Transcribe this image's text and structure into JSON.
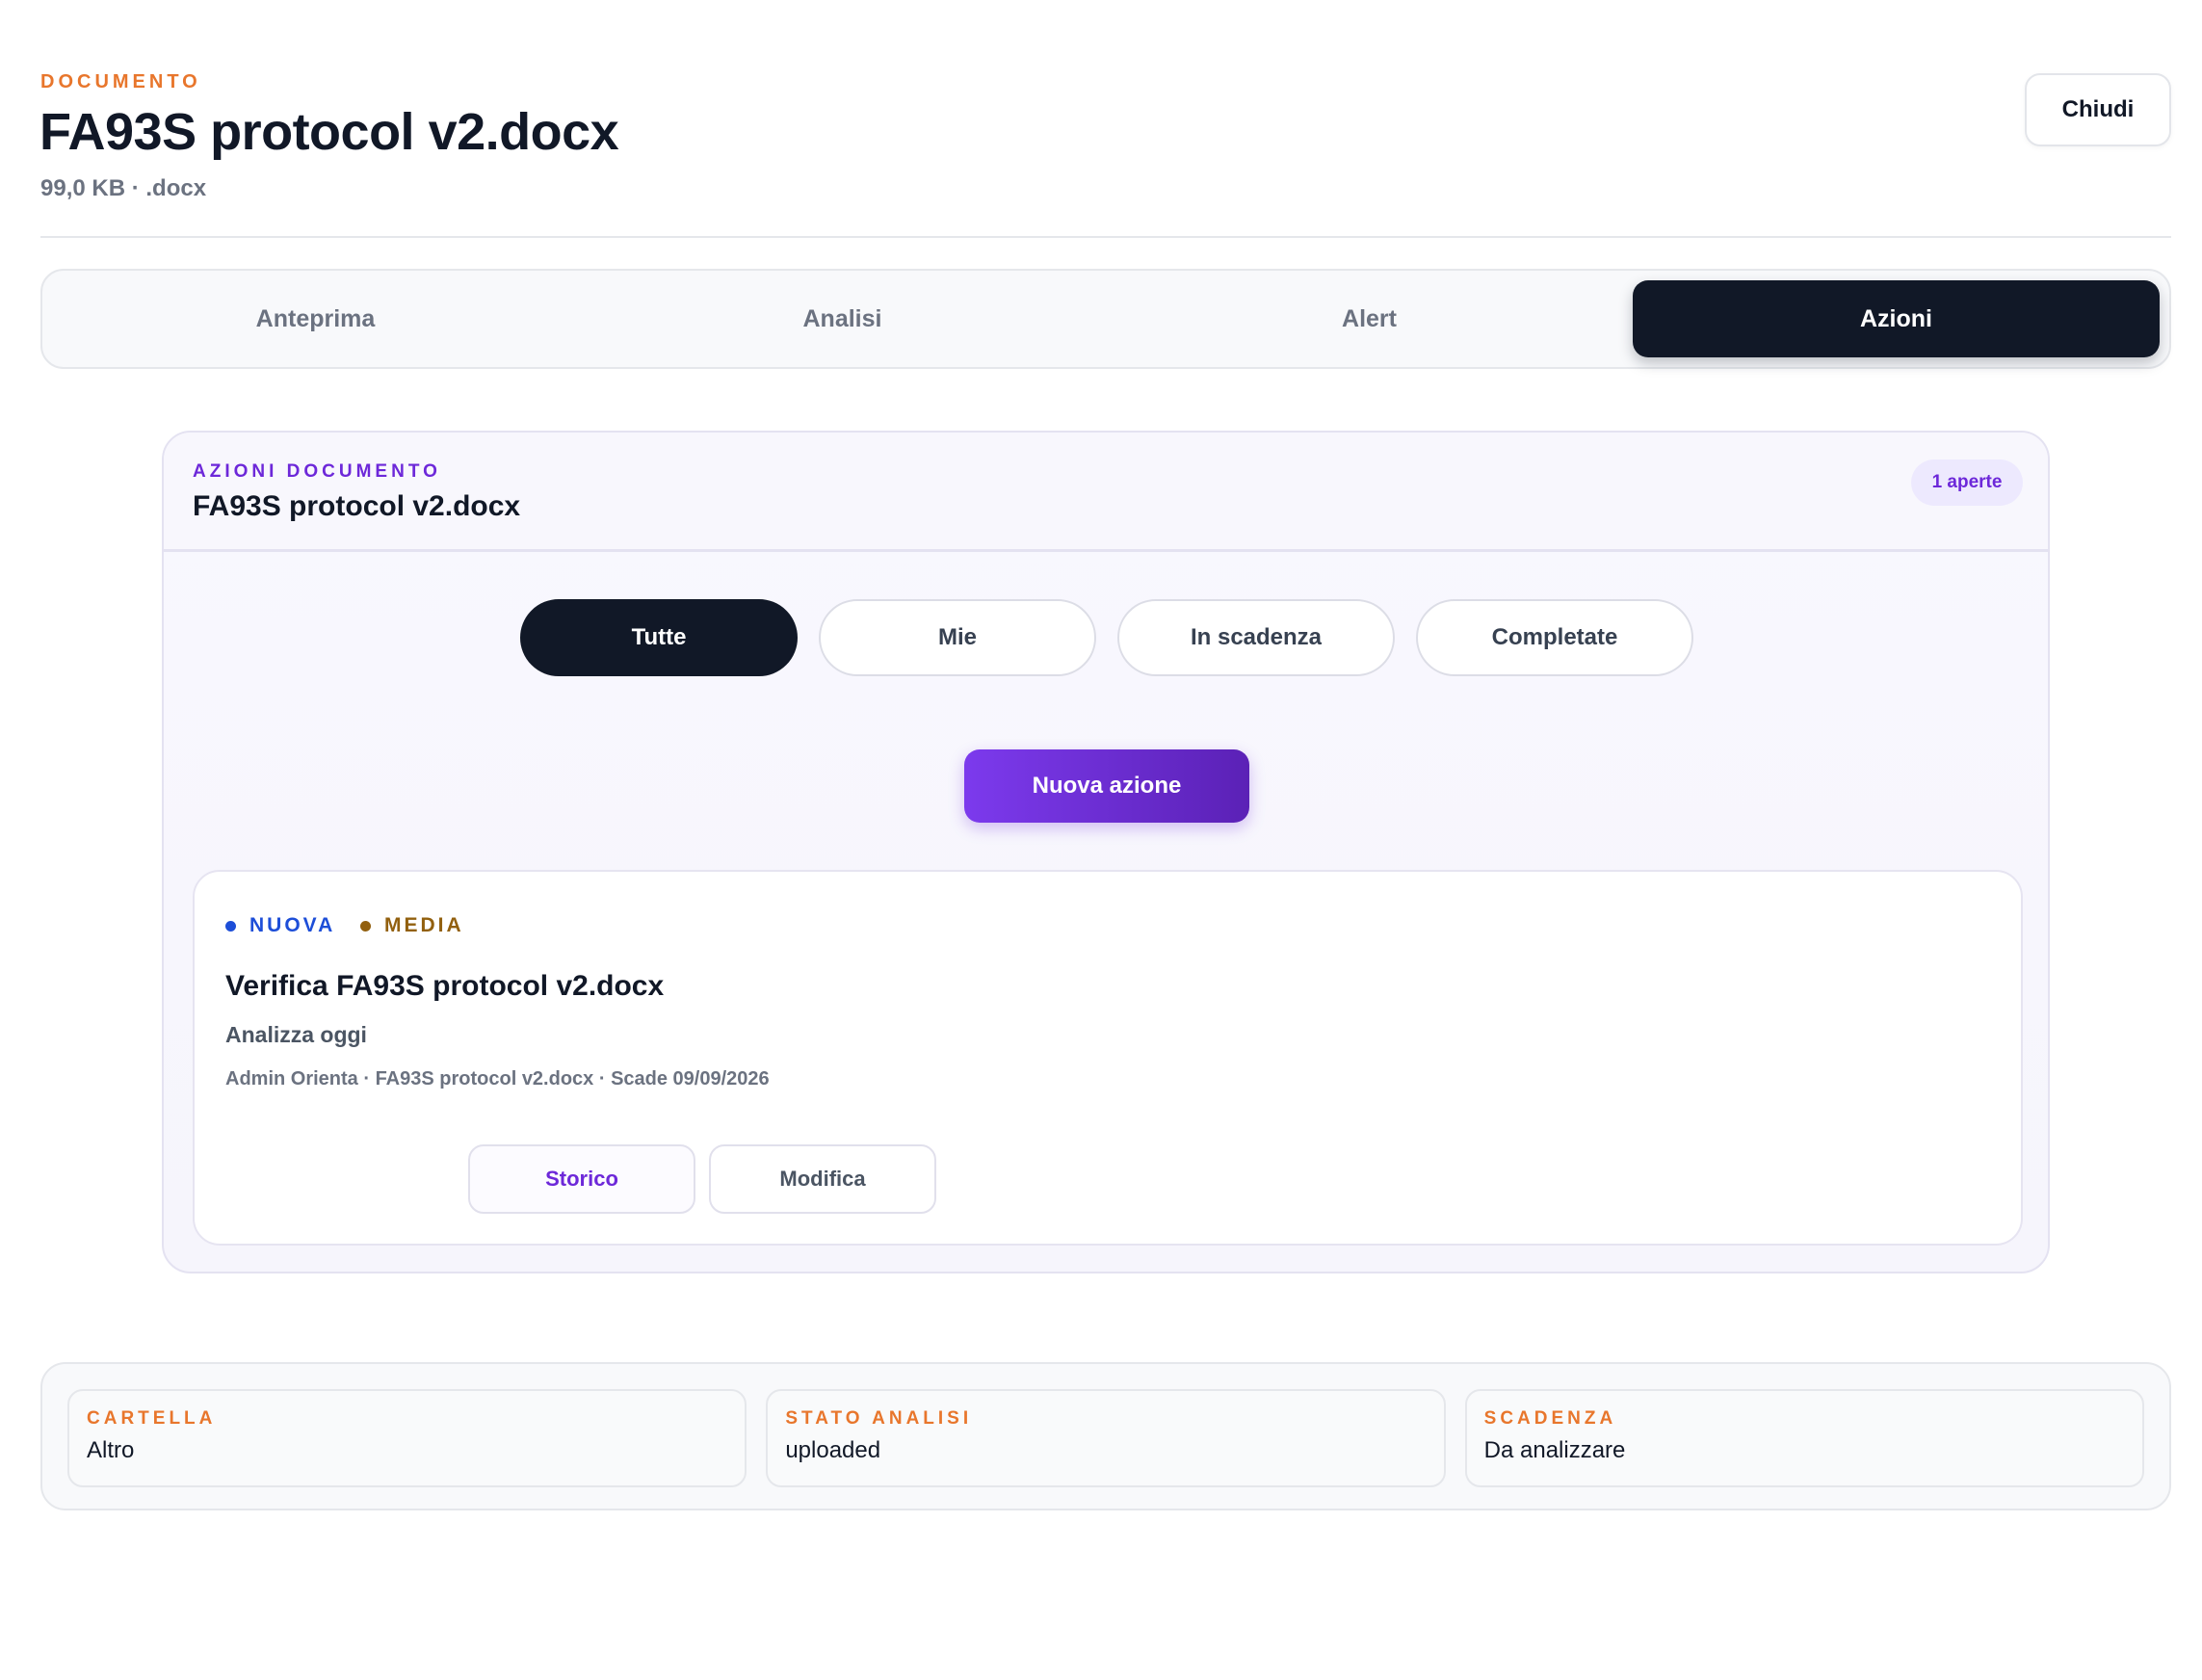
{
  "document": {
    "eyebrow": "DOCUMENTO",
    "title": "FA93S protocol v2.docx",
    "meta": "99,0 KB · .docx",
    "close_label": "Chiudi"
  },
  "tabs": [
    {
      "label": "Anteprima",
      "active": false
    },
    {
      "label": "Analisi",
      "active": false
    },
    {
      "label": "Alert",
      "active": false
    },
    {
      "label": "Azioni",
      "active": true
    }
  ],
  "actions": {
    "eyebrow": "AZIONI DOCUMENTO",
    "title": "FA93S protocol v2.docx",
    "open_badge": "1 aperte",
    "filters": [
      {
        "label": "Tutte",
        "active": true
      },
      {
        "label": "Mie",
        "active": false
      },
      {
        "label": "In scadenza",
        "active": false
      },
      {
        "label": "Completate",
        "active": false
      }
    ],
    "new_action_label": "Nuova azione",
    "items": [
      {
        "status": "NUOVA",
        "priority": "MEDIA",
        "title": "Verifica FA93S protocol v2.docx",
        "description": "Analizza oggi",
        "meta": "Admin Orienta · FA93S protocol v2.docx · Scade 09/09/2026",
        "history_label": "Storico",
        "edit_label": "Modifica"
      }
    ]
  },
  "info": [
    {
      "label": "CARTELLA",
      "value": "Altro"
    },
    {
      "label": "STATO ANALISI",
      "value": "uploaded"
    },
    {
      "label": "SCADENZA",
      "value": "Da analizzare"
    }
  ],
  "colors": {
    "accent_orange": "#e8762c",
    "accent_purple": "#6d28d9",
    "dark": "#111827",
    "status_blue": "#1d4ed8",
    "priority_brown": "#92600f"
  }
}
